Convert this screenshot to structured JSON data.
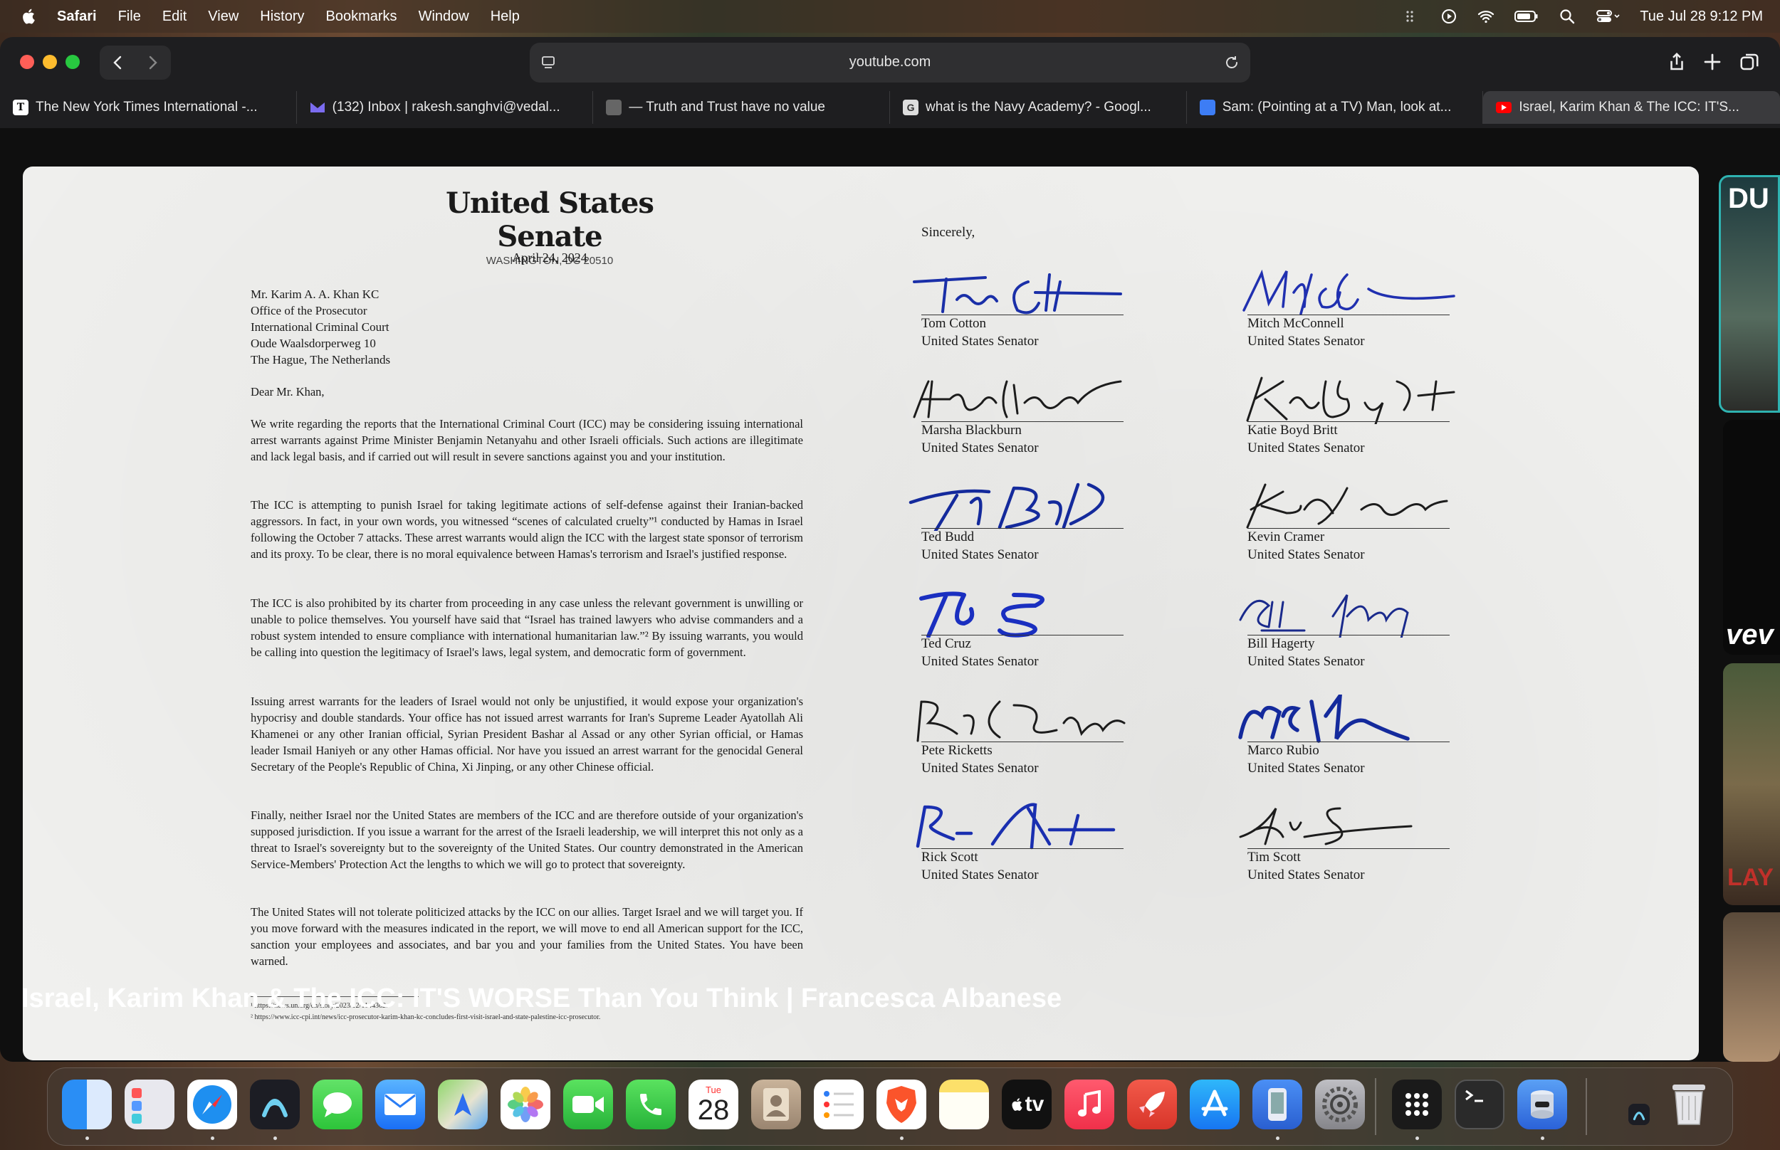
{
  "menubar": {
    "items": [
      "Safari",
      "File",
      "Edit",
      "View",
      "History",
      "Bookmarks",
      "Window",
      "Help"
    ],
    "datetime": "Tue Jul 28  9:12 PM"
  },
  "browser": {
    "address": "youtube.com",
    "tabs": [
      {
        "title": "The New York Times International -..."
      },
      {
        "title": "(132) Inbox | rakesh.sanghvi@vedal..."
      },
      {
        "title": "— Truth and Trust have no value"
      },
      {
        "title": "what is the Navy Academy? - Googl..."
      },
      {
        "title": "Sam: (Pointing at a TV) Man, look at..."
      },
      {
        "title": "Israel, Karim Khan & The ICC: IT'S..."
      }
    ]
  },
  "letter": {
    "header_title": "United States Senate",
    "header_sub": "WASHINGTON, DC 20510",
    "date": "April 24, 2024",
    "address_lines": [
      "Mr. Karim A. A. Khan KC",
      "Office of the Prosecutor",
      "International Criminal Court",
      "Oude Waalsdorperweg 10",
      "The Hague, The Netherlands"
    ],
    "salutation": "Dear Mr. Khan,",
    "paragraphs": [
      "We write regarding the reports that the International Criminal Court (ICC) may be considering issuing international arrest warrants against Prime Minister Benjamin Netanyahu and other Israeli officials. Such actions are illegitimate and lack legal basis, and if carried out will result in severe sanctions against you and your institution.",
      "The ICC is attempting to punish Israel for taking legitimate actions of self-defense against their Iranian-backed aggressors. In fact, in your own words, you witnessed “scenes of calculated cruelty”¹ conducted by Hamas in Israel following the October 7 attacks. These arrest warrants would align the ICC with the largest state sponsor of terrorism and its proxy. To be clear, there is no moral equivalence between Hamas's terrorism and Israel's justified response.",
      "The ICC is also prohibited by its charter from proceeding in any case unless the relevant government is unwilling or unable to police themselves. You yourself have said that “Israel has trained lawyers who advise commanders and a robust system intended to ensure compliance with international humanitarian law.”² By issuing warrants, you would be calling into question the legitimacy of Israel's laws, legal system, and democratic form of government.",
      "Issuing arrest warrants for the leaders of Israel would not only be unjustified, it would expose your organization's hypocrisy and double standards. Your office has not issued arrest warrants for Iran's Supreme Leader Ayatollah Ali Khamenei or any other Iranian official, Syrian President Bashar al Assad or any other Syrian official, or Hamas leader Ismail Haniyeh or any other Hamas official. Nor have you issued an arrest warrant for the genocidal General Secretary of the People's Republic of China, Xi Jinping, or any other Chinese official.",
      "Finally, neither Israel nor the United States are members of the ICC and are therefore outside of your organization's supposed jurisdiction. If you issue a warrant for the arrest of the Israeli leadership, we will interpret this not only as a threat to Israel's sovereignty but to the sovereignty of the United States. Our country demonstrated in the American Service-Members' Protection Act the lengths to which we will go to protect that sovereignty.",
      "The United States will not tolerate politicized attacks by the ICC on our allies. Target Israel and we will target you. If you move forward with the measures indicated in the report, we will move to end all American support for the ICC, sanction your employees and associates, and bar you and your families from the United States. You have been warned."
    ],
    "footnotes": [
      "¹ https://news.un.org/en/story/2023/12/1144362.",
      "² https://www.icc-cpi.int/news/icc-prosecutor-karim-khan-kc-concludes-first-visit-israel-and-state-palestine-icc-prosecutor."
    ],
    "closing": "Sincerely,",
    "signatories": [
      {
        "name": "Tom Cotton",
        "title": "United States Senator"
      },
      {
        "name": "Mitch McConnell",
        "title": "United States Senator"
      },
      {
        "name": "Marsha Blackburn",
        "title": "United States Senator"
      },
      {
        "name": "Katie Boyd Britt",
        "title": "United States Senator"
      },
      {
        "name": "Ted Budd",
        "title": "United States Senator"
      },
      {
        "name": "Kevin Cramer",
        "title": "United States Senator"
      },
      {
        "name": "Ted Cruz",
        "title": "United States Senator"
      },
      {
        "name": "Bill Hagerty",
        "title": "United States Senator"
      },
      {
        "name": "Pete Ricketts",
        "title": "United States Senator"
      },
      {
        "name": "Marco Rubio",
        "title": "United States Senator"
      },
      {
        "name": "Rick Scott",
        "title": "United States Senator"
      },
      {
        "name": "Tim Scott",
        "title": "United States Senator"
      }
    ]
  },
  "video": {
    "title": "Israel, Karim Khan & The ICC: IT'S WORSE Than You Think | Francesca Albanese",
    "side_thumb_texts": [
      "DU",
      "vev",
      "LAY"
    ]
  },
  "dock": {
    "calendar_day": "Tue",
    "calendar_date": "28",
    "tv_label": "tv",
    "apps": [
      "finder-icon",
      "launchpad-icon",
      "safari-icon",
      "arc-icon",
      "messages-icon",
      "mail-icon",
      "maps-icon",
      "photos-icon",
      "facetime-icon",
      "phone-icon",
      "calendar-icon",
      "contacts-icon",
      "reminders-icon",
      "brave-icon",
      "notes-icon",
      "appletv-icon",
      "music-icon",
      "rocket-icon",
      "appstore-icon",
      "device-icon",
      "settings-icon",
      "launcher-icon",
      "terminal-icon",
      "disk-icon",
      "trash-icon"
    ]
  }
}
